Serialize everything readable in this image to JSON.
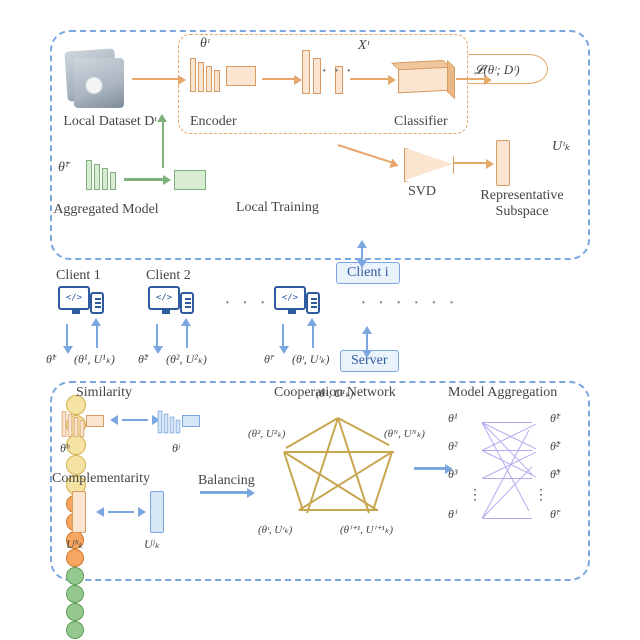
{
  "top": {
    "theta_i": "θᶦ",
    "x_i": "Xᶦ",
    "loss": "𝓛(θᶦ; Dᶦ)",
    "local_dataset": "Local Dataset Dᶦ",
    "encoder": "Encoder",
    "classifier": "Classifier",
    "aggregated_model_sym": "θ̃ᶦ",
    "aggregated_model": "Aggregated Model",
    "local_training": "Local Training",
    "svd": "SVD",
    "rep_subspace": "Representative\nSubspace",
    "u_i": "Uᶦₖ",
    "dots": "· · ·"
  },
  "mid": {
    "client1": "Client 1",
    "client2": "Client 2",
    "clienti": "Client i",
    "server": "Server",
    "theta_tilde_1": "θ̃¹",
    "pair_1": "(θ¹, U¹ₖ)",
    "theta_tilde_2": "θ̃²",
    "pair_2": "(θ², U²ₖ)",
    "theta_tilde_i": "θ̃ᶦ",
    "pair_i": "(θᶦ, Uᶦₖ)",
    "elps": "· · · · · ·"
  },
  "bot": {
    "similarity": "Similarity",
    "complementarity": "Complementarity",
    "theta_h": "θʰ",
    "theta_j": "θʲ",
    "u_h": "Uʰₖ",
    "u_j": "Uʲₖ",
    "balancing": "Balancing",
    "coop_net": "Cooperation Network",
    "model_agg": "Model Aggregation",
    "node_1": "(θ¹, U¹ₖ)",
    "node_2": "(θ², U²ₖ)",
    "node_i": "(θᶦ, Uᶦₖ)",
    "node_ip1": "(θⁱ⁺¹, Uⁱ⁺¹ₖ)",
    "node_N": "(θᴺ, Uᴺₖ)",
    "t1": "θ¹",
    "t2": "θ²",
    "t3": "θ³",
    "ti": "θⁱ",
    "tt1": "θ̃¹",
    "tt2": "θ̃²",
    "tt3": "θ̃³",
    "tti": "θ̃ᶦ"
  }
}
